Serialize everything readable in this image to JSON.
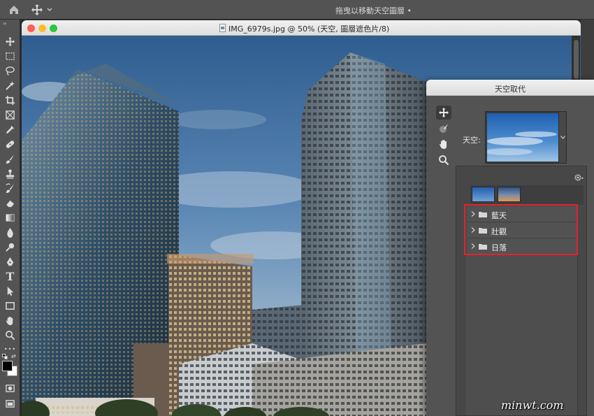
{
  "app": {
    "doc_title_top": "拖曳以移動天空圖層 •"
  },
  "document": {
    "title": "IMG_6979s.jpg @ 50% (天空, 圖層遮色片/8)"
  },
  "toolbar": {
    "collapse": "››",
    "tools": [
      "move-tool-icon",
      "marquee-tool-icon",
      "lasso-tool-icon",
      "magic-wand-icon",
      "crop-tool-icon",
      "frame-tool-icon",
      "eyedropper-icon",
      "healing-brush-icon",
      "brush-tool-icon",
      "clone-stamp-icon",
      "history-brush-icon",
      "eraser-icon",
      "gradient-tool-icon",
      "blur-tool-icon",
      "dodge-tool-icon",
      "pen-tool-icon",
      "type-tool-icon",
      "path-selection-icon",
      "rectangle-tool-icon",
      "hand-tool-icon",
      "zoom-tool-icon",
      "more-tools-icon"
    ],
    "type_glyph": "T",
    "more_glyph": "•••"
  },
  "dialog": {
    "title": "天空取代",
    "sky_label": "天空:",
    "tools": [
      "move-sky-icon",
      "sky-brush-icon",
      "hand-icon",
      "zoom-icon"
    ],
    "folders": [
      {
        "label": "藍天"
      },
      {
        "label": "壯觀"
      },
      {
        "label": "日落"
      }
    ]
  },
  "watermark": "minwt.com",
  "colors": {
    "accent_highlight": "#e3232c",
    "panel": "#535353",
    "close": "#fe5f57",
    "minimize": "#febc2e",
    "zoom": "#28c840"
  }
}
